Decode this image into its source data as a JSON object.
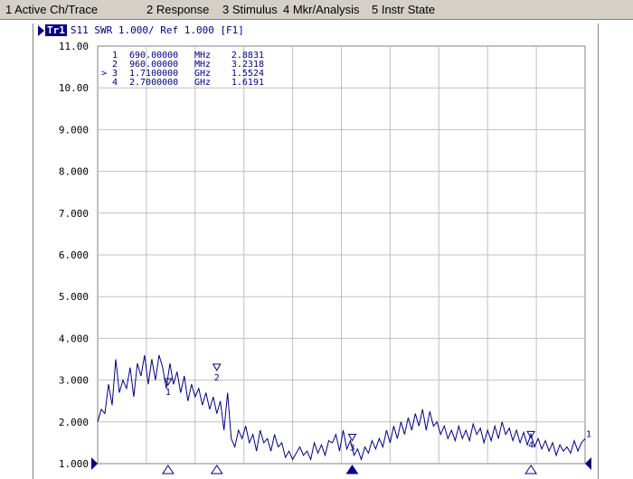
{
  "menu": {
    "items": [
      {
        "label": "1 Active Ch/Trace"
      },
      {
        "label": "2 Response"
      },
      {
        "label": "3 Stimulus"
      },
      {
        "label": "4 Mkr/Analysis"
      },
      {
        "label": "5 Instr State"
      }
    ]
  },
  "trace_header": {
    "tag": "Tr1",
    "text": "S11  SWR 1.000/ Ref 1.000 [F1]"
  },
  "markers": [
    {
      "active": "",
      "num": "1",
      "freq": "690.00000",
      "unit": "MHz",
      "value": "2.8831"
    },
    {
      "active": "",
      "num": "2",
      "freq": "960.00000",
      "unit": "MHz",
      "value": "3.2318"
    },
    {
      "active": ">",
      "num": "3",
      "freq": "1.7100000",
      "unit": "GHz",
      "value": "1.5524"
    },
    {
      "active": "",
      "num": "4",
      "freq": "2.7000000",
      "unit": "GHz",
      "value": "1.6191"
    }
  ],
  "colors": {
    "trace": "#000080",
    "grid": "#c0c0c0",
    "label": "#000000"
  },
  "chart_data": {
    "type": "line",
    "title": "S11  SWR 1.000/ Ref 1.000 [F1]",
    "xlabel": "",
    "ylabel": "",
    "x_unit": "GHz",
    "xlim": [
      0.3,
      3.0
    ],
    "ylim": [
      1.0,
      11.0
    ],
    "grid": true,
    "y_ticks": [
      "1.000",
      "2.000",
      "3.000",
      "4.000",
      "5.000",
      "6.000",
      "7.000",
      "8.000",
      "9.000",
      "10.00",
      "11.00"
    ],
    "series": [
      {
        "x": [
          0.3,
          0.32,
          0.34,
          0.36,
          0.38,
          0.4,
          0.42,
          0.44,
          0.46,
          0.48,
          0.5,
          0.52,
          0.54,
          0.56,
          0.58,
          0.6,
          0.62,
          0.64,
          0.66,
          0.68,
          0.7,
          0.72,
          0.74,
          0.76,
          0.78,
          0.8,
          0.82,
          0.84,
          0.86,
          0.88,
          0.9,
          0.92,
          0.94,
          0.96,
          0.98,
          1.0,
          1.02,
          1.04,
          1.06,
          1.08,
          1.1,
          1.12,
          1.14,
          1.16,
          1.18,
          1.2,
          1.22,
          1.24,
          1.26,
          1.28,
          1.3,
          1.32,
          1.34,
          1.36,
          1.38,
          1.4,
          1.42,
          1.44,
          1.46,
          1.48,
          1.5,
          1.52,
          1.54,
          1.56,
          1.58,
          1.6,
          1.62,
          1.64,
          1.66,
          1.68,
          1.7,
          1.72,
          1.74,
          1.76,
          1.78,
          1.8,
          1.82,
          1.84,
          1.86,
          1.88,
          1.9,
          1.92,
          1.94,
          1.96,
          1.98,
          2.0,
          2.02,
          2.04,
          2.06,
          2.08,
          2.1,
          2.12,
          2.14,
          2.16,
          2.18,
          2.2,
          2.22,
          2.24,
          2.26,
          2.28,
          2.3,
          2.32,
          2.34,
          2.36,
          2.38,
          2.4,
          2.42,
          2.44,
          2.46,
          2.48,
          2.5,
          2.52,
          2.54,
          2.56,
          2.58,
          2.6,
          2.62,
          2.64,
          2.66,
          2.68,
          2.7,
          2.72,
          2.74,
          2.76,
          2.78,
          2.8,
          2.82,
          2.84,
          2.86,
          2.88,
          2.9,
          2.92,
          2.94,
          2.96,
          2.98,
          3.0
        ],
        "values": [
          2.0,
          2.3,
          2.2,
          2.9,
          2.4,
          3.5,
          2.7,
          3.0,
          2.8,
          3.3,
          2.6,
          3.4,
          3.1,
          3.6,
          2.9,
          3.5,
          3.0,
          3.6,
          3.3,
          2.8,
          3.4,
          2.9,
          3.2,
          2.7,
          3.1,
          2.5,
          2.9,
          2.6,
          2.8,
          2.4,
          2.7,
          2.3,
          2.6,
          2.2,
          2.5,
          1.8,
          2.7,
          1.6,
          1.4,
          1.8,
          1.6,
          1.9,
          1.5,
          1.7,
          1.3,
          1.8,
          1.5,
          1.6,
          1.3,
          1.7,
          1.4,
          1.5,
          1.15,
          1.3,
          1.1,
          1.25,
          1.4,
          1.2,
          1.3,
          1.1,
          1.5,
          1.25,
          1.45,
          1.2,
          1.55,
          1.5,
          1.7,
          1.3,
          1.8,
          1.35,
          1.55,
          1.2,
          1.35,
          1.1,
          1.4,
          1.25,
          1.55,
          1.35,
          1.6,
          1.4,
          1.8,
          1.5,
          1.9,
          1.6,
          2.0,
          1.7,
          2.1,
          1.8,
          2.2,
          1.9,
          2.3,
          1.8,
          2.25,
          1.9,
          2.0,
          1.7,
          1.9,
          1.6,
          1.8,
          1.55,
          1.9,
          1.6,
          1.8,
          1.55,
          1.95,
          1.7,
          1.85,
          1.5,
          1.8,
          1.55,
          1.9,
          1.6,
          2.0,
          1.7,
          1.85,
          1.55,
          1.8,
          1.5,
          1.75,
          1.45,
          1.7,
          1.4,
          1.6,
          1.35,
          1.55,
          1.3,
          1.5,
          1.2,
          1.45,
          1.3,
          1.4,
          1.25,
          1.55,
          1.3,
          1.5,
          1.6
        ]
      }
    ],
    "markers": [
      {
        "label": "1",
        "x": 0.69,
        "y": 2.8831
      },
      {
        "label": "2",
        "x": 0.96,
        "y": 3.2318
      },
      {
        "label": "3",
        "x": 1.71,
        "y": 1.5524
      },
      {
        "label": "4",
        "x": 2.7,
        "y": 1.6191
      }
    ]
  }
}
